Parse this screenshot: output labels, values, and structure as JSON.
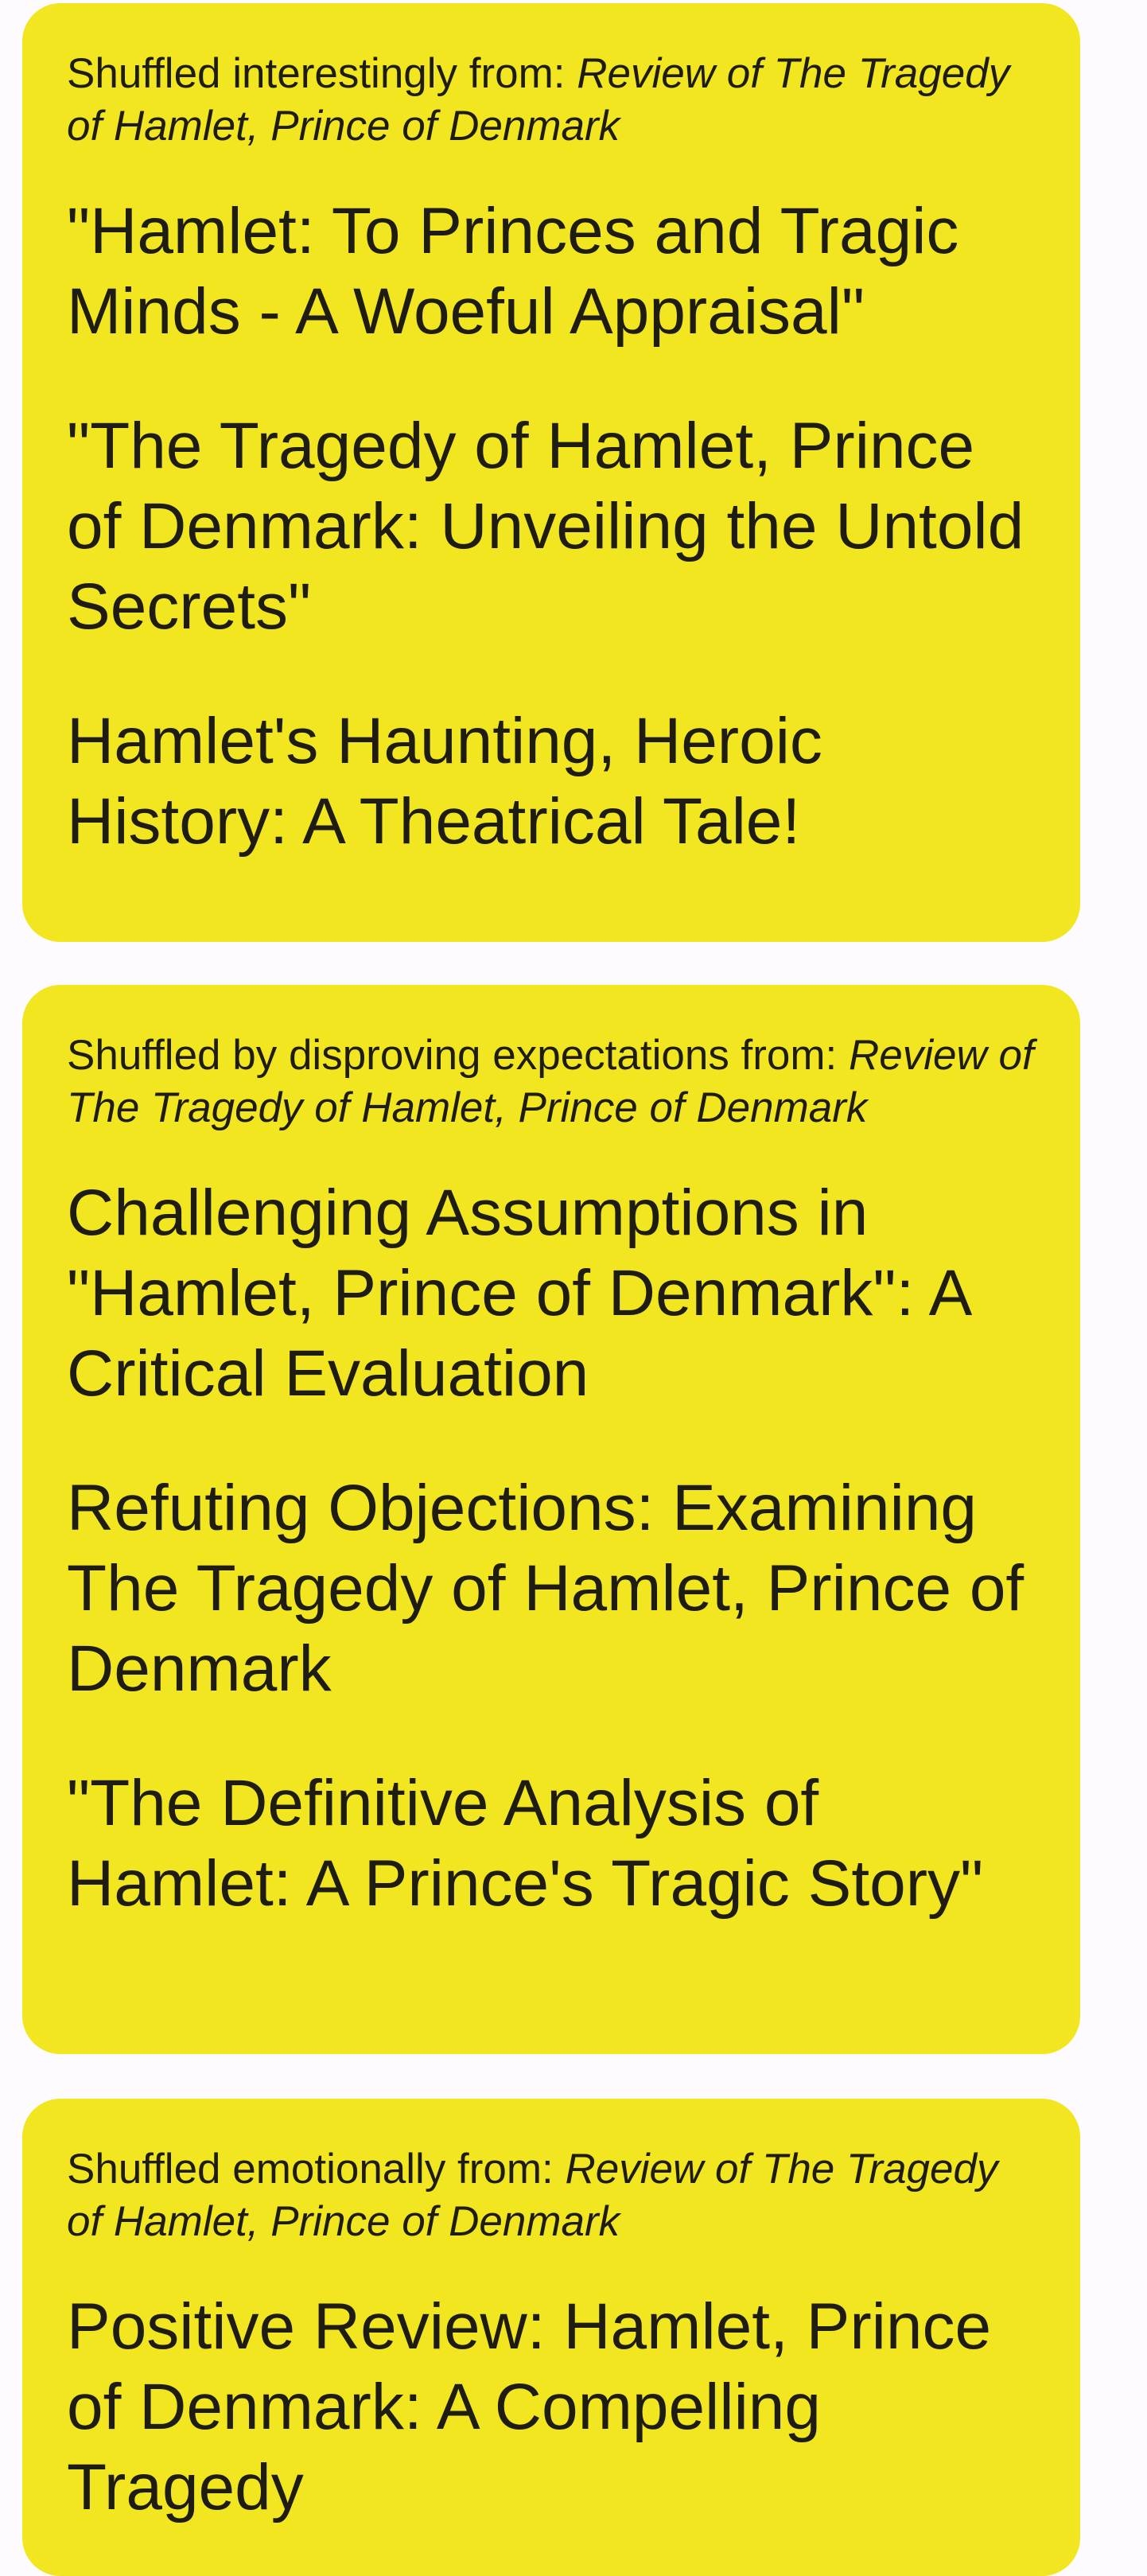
{
  "cards": [
    {
      "prefix": "Shuffled interestingly from: ",
      "source": "Review of The Tragedy of Hamlet, Prince of Denmark",
      "titles": [
        "\"Hamlet: To Princes and Tragic Minds - A Woeful Appraisal\"",
        "\"The Tragedy of Hamlet, Prince of Denmark: Unveiling the Untold Secrets\"",
        "Hamlet's Haunting, Heroic History: A Theatrical Tale!"
      ]
    },
    {
      "prefix": "Shuffled by disproving expectations from: ",
      "source": "Review of The Tragedy of Hamlet, Prince of Denmark",
      "titles": [
        "Challenging Assumptions in \"Hamlet, Prince of Denmark\": A Critical Evaluation",
        "Refuting Objections: Examining The Tragedy of Hamlet, Prince of Denmark",
        "\"The Definitive Analysis of Hamlet: A Prince's Tragic Story\""
      ]
    },
    {
      "prefix": "Shuffled emotionally from: ",
      "source": "Review of The Tragedy of Hamlet, Prince of Denmark",
      "titles": [
        "Positive Review: Hamlet, Prince of Denmark: A Compelling Tragedy"
      ]
    }
  ],
  "colors": {
    "card_background": "#f2e620",
    "page_background": "#fdfbfd",
    "text": "#1f1d12"
  }
}
